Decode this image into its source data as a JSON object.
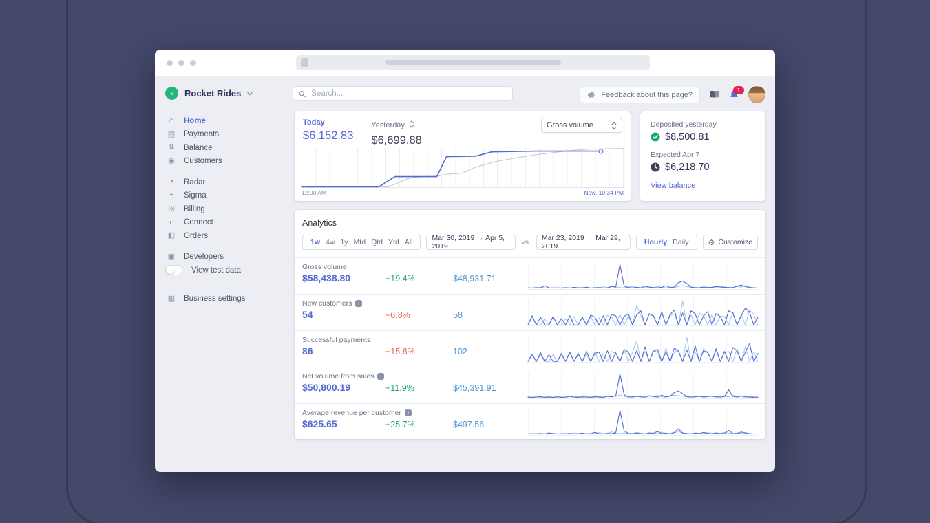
{
  "window": {
    "title": ""
  },
  "icons": {
    "home": "⌂",
    "payments": "▤",
    "balance": "⇅",
    "customers": "◉",
    "radar": "◔",
    "sigma": "◓",
    "billing": "◎",
    "connect": "◐",
    "orders": "◧",
    "developers": "▣",
    "business_settings": "▦",
    "gear": "⚙",
    "info": "i"
  },
  "sidebar": {
    "brand": "Rocket Rides",
    "items": [
      {
        "label": "Home"
      },
      {
        "label": "Payments"
      },
      {
        "label": "Balance"
      },
      {
        "label": "Customers"
      },
      {
        "label": "Radar"
      },
      {
        "label": "Sigma"
      },
      {
        "label": "Billing"
      },
      {
        "label": "Connect"
      },
      {
        "label": "Orders"
      },
      {
        "label": "Developers"
      },
      {
        "label": "View test data"
      },
      {
        "label": "Business settings"
      }
    ],
    "active_item": "Home"
  },
  "topbar": {
    "search_placeholder": "Search...",
    "feedback_label": "Feedback about this page?",
    "notification_count": "1"
  },
  "overview": {
    "today_label": "Today",
    "today_value": "$6,152.83",
    "yesterday_label": "Yesterday",
    "yesterday_value": "$6,699.88",
    "metric_dropdown_value": "Gross volume",
    "x_start": "12:00 AM",
    "x_end": "Now, 10:34 PM"
  },
  "deposits": {
    "deposited_label": "Deposited yesterday",
    "deposited_value": "$8,500.81",
    "expected_label": "Expected Apr 7",
    "expected_value": "$6,218.70",
    "link_label": "View balance"
  },
  "analytics": {
    "title": "Analytics",
    "ranges": [
      "1w",
      "4w",
      "1y",
      "Mtd",
      "Qtd",
      "Ytd",
      "All"
    ],
    "active_range": "1w",
    "current_range": "Mar 30, 2019 →  Apr 5, 2019",
    "vs_label": "vs.",
    "previous_range": "Mar 23, 2019 → Mar 29, 2019",
    "intervals": [
      "Hourly",
      "Daily"
    ],
    "active_interval": "Hourly",
    "customize_label": "Customize",
    "rows": [
      {
        "label": "Gross volume",
        "current": "$58,438.80",
        "delta": "+19.4%",
        "direction": "up",
        "previous": "$48,931.71",
        "info": false
      },
      {
        "label": "New customers",
        "current": "54",
        "delta": "−6.8%",
        "direction": "down",
        "previous": "58",
        "info": true
      },
      {
        "label": "Successful payments",
        "current": "86",
        "delta": "−15.6%",
        "direction": "down",
        "previous": "102",
        "info": false
      },
      {
        "label": "Net volume from sales",
        "current": "$50,800.19",
        "delta": "+11.9%",
        "direction": "up",
        "previous": "$45,391.91",
        "info": true
      },
      {
        "label": "Average revenue per customer",
        "current": "$625.65",
        "delta": "+25.7%",
        "direction": "up",
        "previous": "$497.56",
        "info": true
      }
    ]
  },
  "colors": {
    "accent": "#5469d4",
    "positive": "#21a56e",
    "negative": "#e5654e",
    "previous_blue": "#4f96d8",
    "spark_current": "#5469d4",
    "spark_previous": "#9cc4ee",
    "yesterday_line": "#c5cbd8",
    "brand_green": "#24b47e"
  },
  "chart_data": [
    {
      "id": "gross-volume-overview",
      "type": "line",
      "title": "Gross volume today vs yesterday",
      "x_start_label": "12:00 AM",
      "x_end_label": "Now, 10:34 PM",
      "y_values_shown": [
        "$6,152.83",
        "$6,699.88"
      ],
      "series": [
        {
          "name": "Yesterday",
          "color": "#c5cbd8",
          "width": 1.2,
          "points": [
            [
              0,
              1
            ],
            [
              27,
              1
            ],
            [
              33,
              22
            ],
            [
              37,
              27
            ],
            [
              42,
              28
            ],
            [
              45,
              33
            ],
            [
              50,
              36
            ],
            [
              54,
              51
            ],
            [
              60,
              65
            ],
            [
              66,
              74
            ],
            [
              73,
              83
            ],
            [
              84,
              94
            ],
            [
              89,
              97
            ],
            [
              100,
              99
            ]
          ]
        },
        {
          "name": "Today",
          "color": "#5469d4",
          "width": 1.6,
          "points": [
            [
              0,
              1
            ],
            [
              24,
              1
            ],
            [
              29,
              27
            ],
            [
              42,
              27
            ],
            [
              45,
              78
            ],
            [
              54,
              79
            ],
            [
              59,
              90
            ],
            [
              73,
              92
            ],
            [
              93,
              92
            ]
          ]
        }
      ],
      "end_dot": [
        93,
        92
      ],
      "gridlines": 24
    },
    {
      "id": "spark-gross-volume",
      "type": "line",
      "series": [
        {
          "name": "previous",
          "color": "#9cc4ee",
          "width": 1,
          "values": [
            2,
            3,
            2,
            6,
            3,
            2,
            4,
            2,
            3,
            5,
            3,
            2,
            4,
            6,
            3,
            2,
            5,
            3,
            7,
            4,
            10,
            6,
            4,
            3,
            6,
            9,
            5,
            3,
            4,
            6,
            4,
            8,
            5,
            3,
            6,
            4,
            8,
            12,
            8,
            5,
            3,
            4,
            7,
            5,
            4,
            6,
            10,
            6,
            4,
            5,
            8,
            6,
            12,
            6,
            3,
            2
          ]
        },
        {
          "name": "current",
          "color": "#5469d4",
          "width": 1.1,
          "values": [
            3,
            2,
            4,
            2,
            12,
            3,
            2,
            3,
            2,
            3,
            2,
            5,
            3,
            2,
            6,
            2,
            3,
            4,
            2,
            3,
            8,
            6,
            98,
            10,
            4,
            3,
            5,
            3,
            10,
            6,
            4,
            3,
            5,
            12,
            4,
            6,
            24,
            30,
            20,
            6,
            4,
            3,
            6,
            4,
            5,
            8,
            6,
            5,
            4,
            3,
            10,
            14,
            8,
            4,
            3,
            2
          ]
        }
      ]
    },
    {
      "id": "spark-new-customers",
      "type": "line",
      "series": [
        {
          "name": "previous",
          "color": "#9cc4ee",
          "width": 1,
          "values": [
            0,
            20,
            0,
            0,
            18,
            0,
            22,
            0,
            0,
            18,
            0,
            24,
            0,
            20,
            0,
            24,
            0,
            20,
            0,
            28,
            22,
            0,
            30,
            0,
            24,
            0,
            56,
            26,
            0,
            32,
            24,
            0,
            38,
            0,
            26,
            32,
            0,
            68,
            0,
            28,
            0,
            34,
            26,
            0,
            30,
            0,
            24,
            24,
            0,
            36,
            0,
            30,
            0,
            42,
            30,
            0
          ]
        },
        {
          "name": "current",
          "color": "#5469d4",
          "width": 1.1,
          "values": [
            0,
            26,
            0,
            22,
            0,
            0,
            24,
            0,
            18,
            0,
            26,
            0,
            0,
            22,
            0,
            28,
            22,
            0,
            26,
            0,
            30,
            26,
            0,
            24,
            32,
            0,
            28,
            40,
            0,
            32,
            26,
            0,
            36,
            0,
            30,
            42,
            0,
            34,
            0,
            40,
            32,
            0,
            26,
            38,
            0,
            32,
            24,
            0,
            40,
            34,
            0,
            26,
            48,
            36,
            0,
            22
          ]
        }
      ]
    },
    {
      "id": "spark-successful-payments",
      "type": "line",
      "series": [
        {
          "name": "previous",
          "color": "#9cc4ee",
          "width": 1,
          "values": [
            0,
            18,
            0,
            20,
            0,
            0,
            22,
            0,
            18,
            0,
            24,
            0,
            26,
            0,
            20,
            0,
            28,
            0,
            22,
            0,
            30,
            24,
            0,
            34,
            0,
            28,
            62,
            0,
            30,
            0,
            36,
            26,
            0,
            40,
            0,
            28,
            34,
            0,
            72,
            0,
            30,
            0,
            38,
            28,
            0,
            32,
            0,
            26,
            30,
            0,
            38,
            0,
            44,
            0,
            30,
            0
          ]
        },
        {
          "name": "current",
          "color": "#5469d4",
          "width": 1.1,
          "values": [
            0,
            22,
            0,
            26,
            0,
            20,
            0,
            0,
            24,
            0,
            28,
            0,
            22,
            0,
            30,
            0,
            24,
            28,
            0,
            32,
            0,
            26,
            0,
            36,
            28,
            0,
            32,
            0,
            44,
            0,
            30,
            36,
            0,
            28,
            0,
            40,
            30,
            0,
            34,
            0,
            46,
            0,
            32,
            26,
            0,
            38,
            0,
            30,
            0,
            42,
            32,
            0,
            28,
            54,
            0,
            24
          ]
        }
      ]
    },
    {
      "id": "spark-net-volume",
      "type": "line",
      "series": [
        {
          "name": "previous",
          "color": "#9cc4ee",
          "width": 1,
          "values": [
            2,
            3,
            4,
            2,
            3,
            5,
            2,
            3,
            4,
            2,
            5,
            3,
            6,
            2,
            4,
            3,
            2,
            6,
            3,
            5,
            8,
            5,
            12,
            6,
            3,
            5,
            8,
            4,
            3,
            6,
            5,
            9,
            4,
            3,
            7,
            10,
            8,
            6,
            4,
            3,
            5,
            8,
            4,
            6,
            5,
            3,
            8,
            5,
            4,
            10,
            6,
            4,
            3,
            5,
            4,
            2
          ]
        },
        {
          "name": "current",
          "color": "#5469d4",
          "width": 1.1,
          "values": [
            3,
            2,
            3,
            5,
            2,
            3,
            2,
            4,
            2,
            3,
            6,
            3,
            2,
            4,
            3,
            2,
            5,
            3,
            2,
            6,
            4,
            8,
            90,
            12,
            4,
            3,
            6,
            4,
            3,
            8,
            5,
            3,
            10,
            4,
            6,
            20,
            26,
            16,
            5,
            3,
            4,
            6,
            3,
            5,
            7,
            4,
            3,
            5,
            30,
            6,
            3,
            8,
            4,
            3,
            2,
            3
          ]
        }
      ]
    },
    {
      "id": "spark-avg-revenue",
      "type": "line",
      "series": [
        {
          "name": "previous",
          "color": "#9cc4ee",
          "width": 1,
          "values": [
            3,
            2,
            4,
            2,
            3,
            2,
            5,
            2,
            3,
            4,
            2,
            6,
            3,
            2,
            4,
            3,
            2,
            7,
            3,
            4,
            10,
            5,
            3,
            6,
            4,
            3,
            8,
            5,
            3,
            4,
            6,
            3,
            9,
            4,
            3,
            6,
            12,
            5,
            4,
            3,
            6,
            4,
            3,
            7,
            5,
            3,
            4,
            8,
            5,
            3,
            6,
            4,
            8,
            3,
            2,
            2
          ]
        },
        {
          "name": "current",
          "color": "#5469d4",
          "width": 1.1,
          "values": [
            2,
            3,
            2,
            4,
            2,
            6,
            3,
            2,
            3,
            2,
            4,
            2,
            3,
            5,
            2,
            3,
            8,
            3,
            2,
            4,
            3,
            6,
            96,
            14,
            4,
            3,
            5,
            3,
            2,
            6,
            4,
            12,
            3,
            5,
            2,
            8,
            22,
            6,
            3,
            2,
            5,
            3,
            8,
            4,
            2,
            6,
            3,
            4,
            16,
            4,
            3,
            10,
            5,
            3,
            2,
            2
          ]
        }
      ]
    }
  ]
}
